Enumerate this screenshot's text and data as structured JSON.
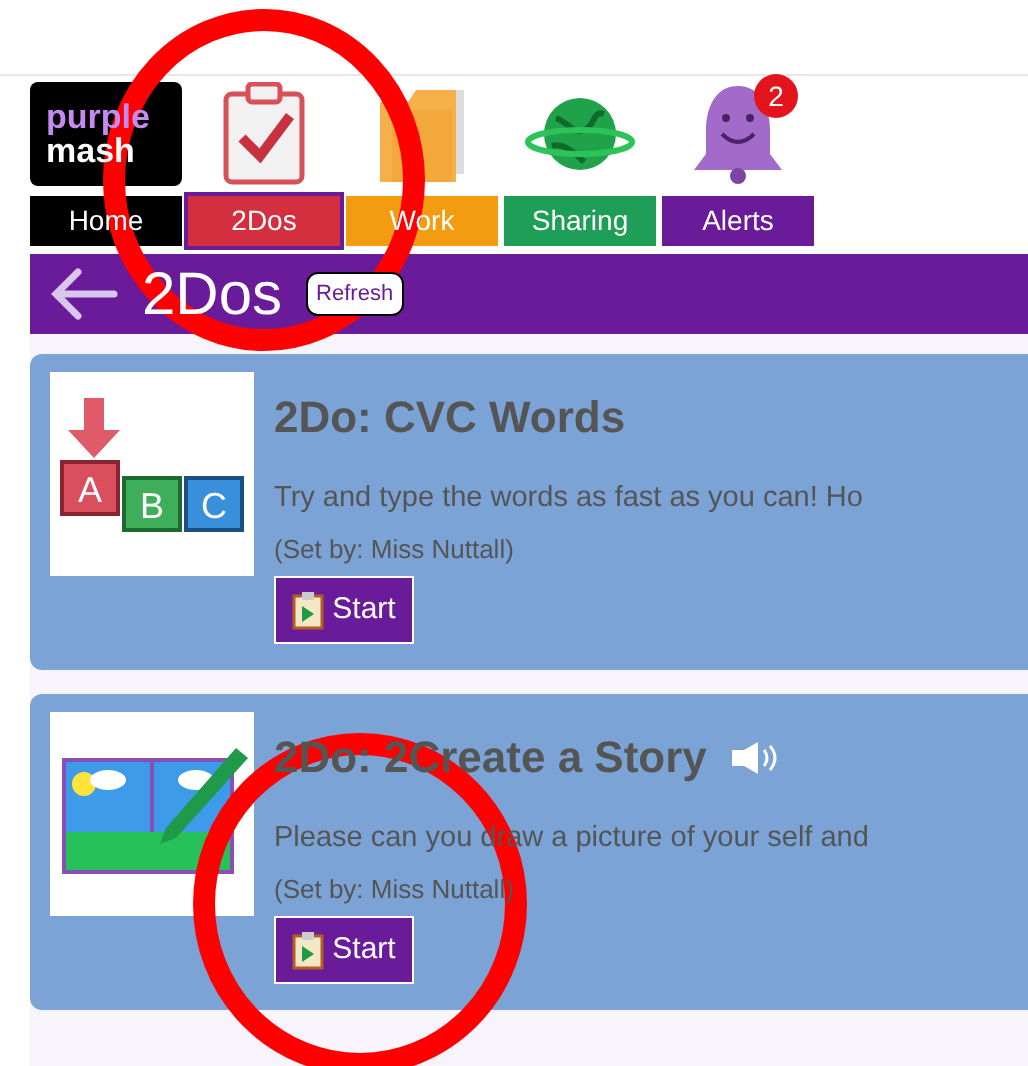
{
  "nav": [
    {
      "kind": "logo",
      "logo_lines": [
        "purple",
        "mash"
      ],
      "label": "Home",
      "selected": false
    },
    {
      "kind": "clipboard",
      "label": "2Dos",
      "selected": true
    },
    {
      "kind": "folder",
      "label": "Work",
      "selected": false
    },
    {
      "kind": "globe",
      "label": "Sharing",
      "selected": false
    },
    {
      "kind": "bell",
      "label": "Alerts",
      "badge": "2",
      "selected": false
    }
  ],
  "header": {
    "title": "2Dos",
    "refresh": "Refresh"
  },
  "todos": [
    {
      "kind": "abc",
      "block_letters": [
        "A",
        "B",
        "C"
      ],
      "title": "2Do: CVC Words",
      "audio": false,
      "description": "Try and type the words as fast as you can! Ho",
      "set_by": "(Set by: Miss Nuttall)",
      "button": "Start"
    },
    {
      "kind": "book",
      "title": "2Do: 2Create a Story",
      "audio": true,
      "description": "Please can you draw a picture of your self and",
      "set_by": "(Set by: Miss Nuttall)",
      "button": "Start"
    }
  ],
  "annotations": [
    {
      "kind": "circle"
    },
    {
      "kind": "circle"
    }
  ]
}
